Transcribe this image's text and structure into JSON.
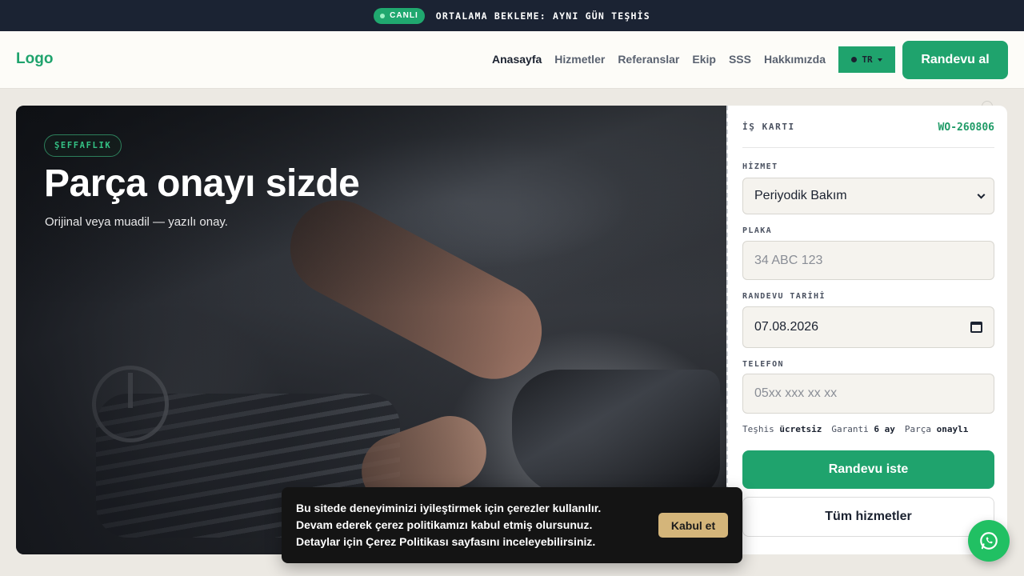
{
  "topbar": {
    "live_label": "CANLI",
    "message": "ORTALAMA BEKLEME: AYNI GÜN TEŞHİS"
  },
  "header": {
    "logo": "Logo",
    "nav": [
      {
        "label": "Anasayfa",
        "active": true
      },
      {
        "label": "Hizmetler"
      },
      {
        "label": "Referanslar"
      },
      {
        "label": "Ekip"
      },
      {
        "label": "SSS"
      },
      {
        "label": "Hakkımızda"
      }
    ],
    "language": "TR",
    "cta_label": "Randevu al"
  },
  "hero": {
    "badge": "ŞEFFAFLIK",
    "title": "Parça onayı sizde",
    "subtitle": "Orijinal veya muadil — yazılı onay."
  },
  "work_card": {
    "label": "İŞ KARTI",
    "id": "WO-260806",
    "service_label": "HİZMET",
    "service_value": "Periyodik Bakım",
    "plate_label": "PLAKA",
    "plate_placeholder": "34 ABC 123",
    "date_label": "RANDEVU TARİHİ",
    "date_value": "07.08.2026",
    "phone_label": "TELEFON",
    "phone_placeholder": "05xx xxx xx xx",
    "meta": [
      {
        "key": "Teşhis",
        "value": "ücretsiz"
      },
      {
        "key": "Garanti",
        "value": "6 ay"
      },
      {
        "key": "Parça",
        "value": "onaylı"
      }
    ],
    "submit_label": "Randevu iste",
    "secondary_label": "Tüm hizmetler"
  },
  "cookie": {
    "text": "Bu sitede deneyiminizi iyileştirmek için çerezler kullanılır. Devam ederek çerez politikamızı kabul etmiş olursunuz. Detaylar için Çerez Politikası sayfasını inceleyebilirsiniz.",
    "accept_label": "Kabul et"
  },
  "colors": {
    "accent": "#1fa36d",
    "topbar_bg": "#1b2333",
    "cookie_button": "#d4b57a",
    "whatsapp": "#21c063"
  },
  "icons": [
    "live-dot-icon",
    "caret-down-icon",
    "calendar-icon",
    "whatsapp-icon"
  ]
}
